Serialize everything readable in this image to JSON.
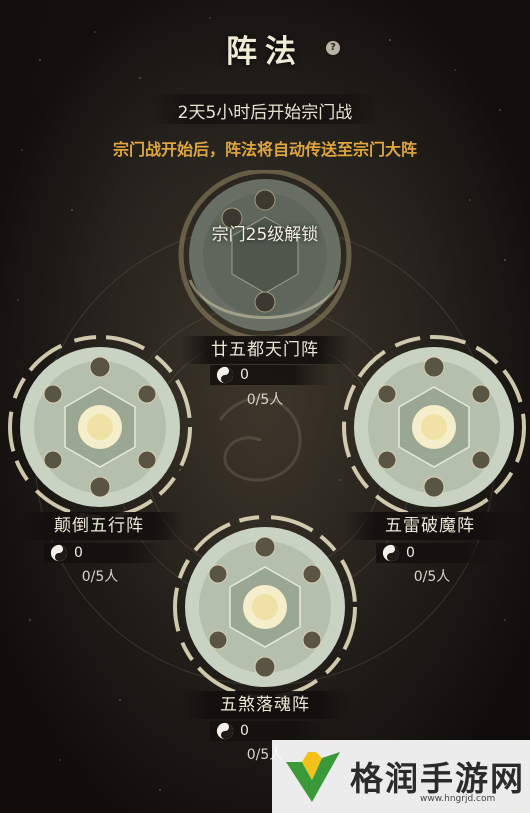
{
  "title": "阵法",
  "help_icon": "?",
  "countdown": "2天5小时后开始宗门战",
  "notice": "宗门战开始后，阵法将自动传送至宗门大阵",
  "locked_formation": {
    "unlock_text": "宗门25级解锁",
    "name": "廿五都天门阵",
    "value": "0",
    "capacity": "0/5人"
  },
  "formations": [
    {
      "name": "颠倒五行阵",
      "value": "0",
      "capacity": "0/5人"
    },
    {
      "name": "五雷破魔阵",
      "value": "0",
      "capacity": "0/5人"
    },
    {
      "name": "五煞落魂阵",
      "value": "0",
      "capacity": "0/5人"
    }
  ],
  "icons": {
    "stat": "yin-yang-icon",
    "help": "question-icon"
  },
  "colors": {
    "notice": "#dfa640",
    "title": "#f1ead6",
    "disc": "#cdd8c8",
    "glow": "#fff6d0"
  },
  "watermark": {
    "name": "格润手游网",
    "url": "www.hngrjd.com"
  }
}
